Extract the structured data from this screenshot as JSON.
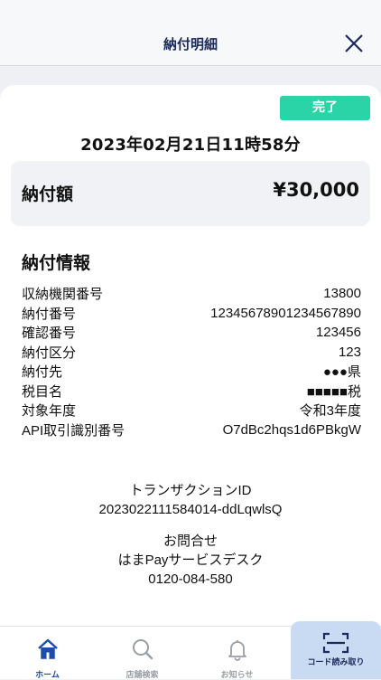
{
  "header": {
    "title": "納付明細"
  },
  "receipt": {
    "status": "完了",
    "datetime": "2023年02月21日11時58分",
    "amount_label": "納付額",
    "amount_value": "¥30,000",
    "info_title": "納付情報",
    "info_rows": [
      {
        "label": "収納機関番号",
        "value": "13800"
      },
      {
        "label": "納付番号",
        "value": "12345678901234567890"
      },
      {
        "label": "確認番号",
        "value": "123456"
      },
      {
        "label": "納付区分",
        "value": "123"
      },
      {
        "label": "納付先",
        "value": "●●●県"
      },
      {
        "label": "税目名",
        "value": "■■■■■税"
      },
      {
        "label": "対象年度",
        "value": "令和3年度"
      },
      {
        "label": "API取引識別番号",
        "value": "O7dBc2hqs1d6PBkgW"
      }
    ],
    "transaction_label": "トランザクションID",
    "transaction_id": "2023022111584014-ddLqwlsQ",
    "contact_label": "お問合せ",
    "contact_name": "はまPayサービスデスク",
    "contact_phone": "0120-084-580"
  },
  "tabs": [
    {
      "label": "ホーム",
      "icon": "home-icon",
      "active": true
    },
    {
      "label": "店舗検索",
      "icon": "search-icon",
      "active": false
    },
    {
      "label": "お知らせ",
      "icon": "bell-icon",
      "active": false
    },
    {
      "label": "コード読み取り",
      "icon": "scan-icon",
      "active": false
    }
  ],
  "colors": {
    "accent": "#1a4ea8",
    "status_badge": "#2ad4a6",
    "scan_tab_bg": "#c9dbf3"
  }
}
